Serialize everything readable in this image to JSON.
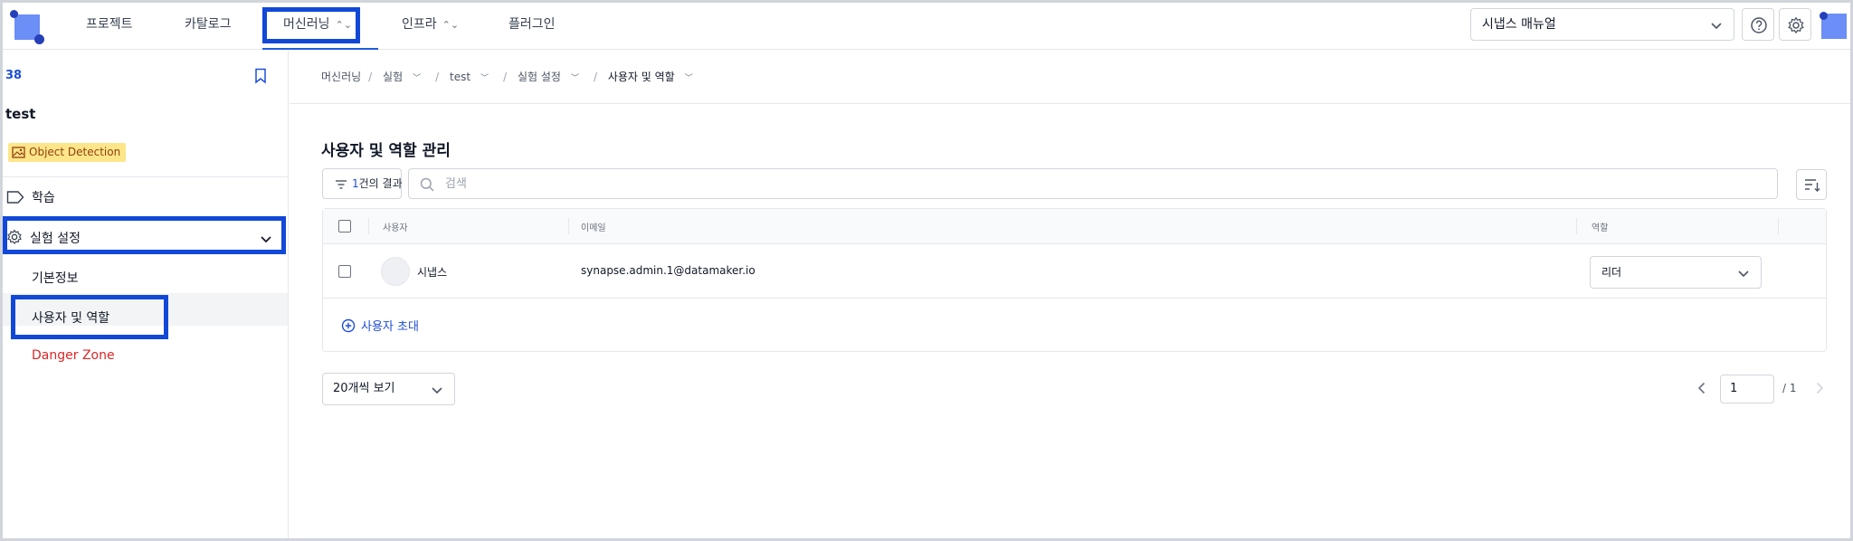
{
  "topnav": {
    "items": [
      {
        "label": "프로젝트"
      },
      {
        "label": "카탈로그"
      },
      {
        "label": "머신러닝",
        "active": true
      },
      {
        "label": "인프라"
      },
      {
        "label": "플러그인"
      }
    ],
    "manual_select": "시냅스 매뉴얼"
  },
  "sidebar": {
    "project_id": "38",
    "project_name": "test",
    "tag": "Object Detection",
    "items": {
      "train": "학습",
      "experiment_settings": "실험 설정",
      "basic_info": "기본정보",
      "users_roles": "사용자 및 역할",
      "danger_zone": "Danger Zone"
    }
  },
  "breadcrumb": [
    "머신러닝",
    "실험",
    "test",
    "실험 설정",
    "사용자 및 역할"
  ],
  "main": {
    "title": "사용자 및 역할 관리",
    "filter": {
      "count": "1",
      "suffix": "건의 결과"
    },
    "search": {
      "placeholder": "검색",
      "value": ""
    },
    "table": {
      "headers": {
        "user": "사용자",
        "email": "이메일",
        "role": "역할"
      },
      "rows": [
        {
          "name": "시냅스",
          "email": "synapse.admin.1@datamaker.io",
          "role": "리더"
        }
      ]
    },
    "invite_label": "사용자 초대",
    "per_page": "20개씩 보기",
    "pagination": {
      "current": "1",
      "total": "/ 1"
    }
  },
  "colors": {
    "accent": "#1d4ed8",
    "highlight_border": "#1148d8",
    "danger": "#dc2626",
    "tag_bg": "#fde68a"
  }
}
